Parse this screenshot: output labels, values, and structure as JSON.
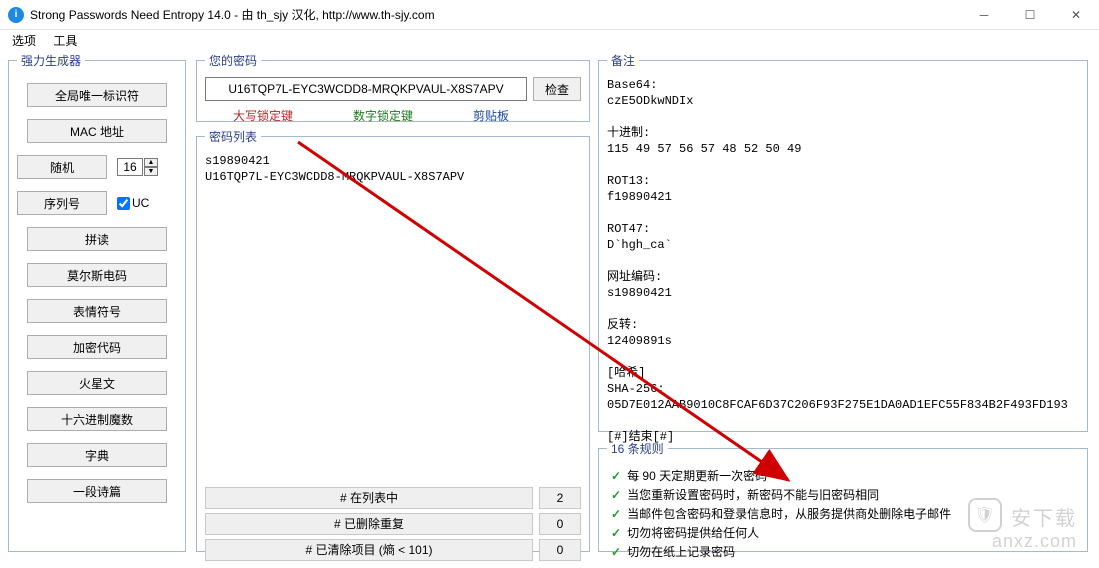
{
  "window": {
    "title": "Strong Passwords Need Entropy 14.0 - 由 th_sjy 汉化, http://www.th-sjy.com",
    "icon_letter": "i"
  },
  "menubar": {
    "options": "选项",
    "tools": "工具"
  },
  "generator": {
    "legend": "强力生成器",
    "buttons": [
      "全局唯一标识符",
      "MAC 地址",
      "随机",
      "序列号",
      "拼读",
      "莫尔斯电码",
      "表情符号",
      "加密代码",
      "火星文",
      "十六进制魔数",
      "字典",
      "一段诗篇"
    ],
    "spinner_value": "16",
    "uc_label": "UC",
    "uc_checked": true
  },
  "password": {
    "legend": "您的密码",
    "value": "U16TQP7L-EYC3WCDD8-MRQKPVAUL-X8S7APV",
    "check_label": "检查",
    "caps": "大写锁定键",
    "num": "数字锁定键",
    "clip": "剪贴板"
  },
  "list": {
    "legend": "密码列表",
    "content": "s19890421\nU16TQP7L-EYC3WCDD8-MRQKPVAUL-X8S7APV",
    "stats": [
      {
        "label": "# 在列表中",
        "value": "2"
      },
      {
        "label": "# 已删除重复",
        "value": "0"
      },
      {
        "label": "# 已清除项目 (熵 < 101)",
        "value": "0"
      }
    ]
  },
  "notes": {
    "legend": "备注",
    "content": "Base64:\nczE5ODkwNDIx\n\n十进制:\n115 49 57 56 57 48 52 50 49\n\nROT13:\nf19890421\n\nROT47:\nD`hgh_ca`\n\n网址编码:\ns19890421\n\n反转:\n12409891s\n\n[哈希]\nSHA-256:\n05D7E012AAB9010C8FCAF6D37C206F93F275E1DA0AD1EFC55F834B2F493FD193\n\n[#]结束[#]"
  },
  "rules": {
    "legend": "16 条规则",
    "items": [
      "每 90 天定期更新一次密码",
      "当您重新设置密码时，新密码不能与旧密码相同",
      "当邮件包含密码和登录信息时，从服务提供商处删除电子邮件",
      "切勿将密码提供给任何人",
      "切勿在纸上记录密码"
    ]
  },
  "watermark": {
    "cn": "安下载",
    "url": "anxz.com",
    "shield": "🛡"
  }
}
